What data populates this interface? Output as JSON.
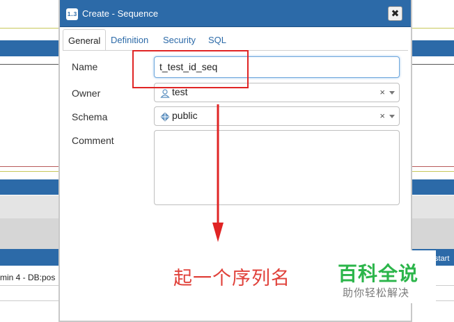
{
  "background": {
    "status_text": "min 4 - DB:pos",
    "right_label": "start"
  },
  "dialog": {
    "title": "Create - Sequence",
    "title_icon_text": "1..3",
    "close_glyph": "✖",
    "tabs": [
      {
        "label": "General",
        "active": true
      },
      {
        "label": "Definition",
        "active": false
      },
      {
        "label": "Security",
        "active": false
      },
      {
        "label": "SQL",
        "active": false
      }
    ],
    "fields": {
      "name": {
        "label": "Name",
        "value": "t_test_id_seq"
      },
      "owner": {
        "label": "Owner",
        "value": "test",
        "icon": "user-icon",
        "clear": "×"
      },
      "schema": {
        "label": "Schema",
        "value": "public",
        "icon": "schema-icon",
        "clear": "×"
      },
      "comment": {
        "label": "Comment",
        "value": ""
      }
    }
  },
  "annotation": {
    "caption": "起一个序列名",
    "color": "#e0413a"
  },
  "watermark": {
    "title": "百科全说",
    "subtitle": "助你轻松解决"
  },
  "colors": {
    "titlebar": "#2c6aa8",
    "tab_link": "#2c6aa8",
    "highlight": "#e02424",
    "watermark_green": "#2bb54a"
  }
}
